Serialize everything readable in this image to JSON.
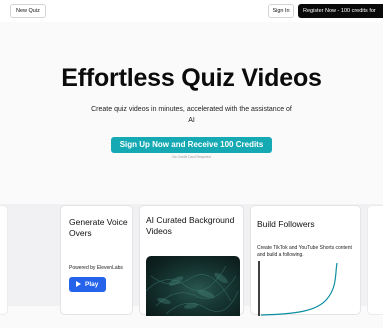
{
  "header": {
    "new_quiz_label": "New Quiz",
    "sign_in_label": "Sign In",
    "register_label": "Register Now - 100 credits for"
  },
  "hero": {
    "title": "Effortless Quiz Videos",
    "subtitle": "Create quiz videos in minutes, accelerated with the assistance of AI",
    "cta_label": "Sign Up Now and Receive 100 Credits",
    "cta_note": "No Credit Card Required"
  },
  "features": [
    {
      "title": "Generate Voice Overs",
      "description": "Powered by ElevenLabs",
      "button_label": "Play",
      "button_icon": "play-icon"
    },
    {
      "title": "AI Curated Background Videos"
    },
    {
      "title": "Build Followers",
      "description": "Create TikTok and YouTube Shorts content and build a following."
    }
  ],
  "colors": {
    "cta": "#14a9b3",
    "play_button": "#2563eb",
    "register_button": "#0a0a0a",
    "growth_line": "#0d8ea0"
  }
}
